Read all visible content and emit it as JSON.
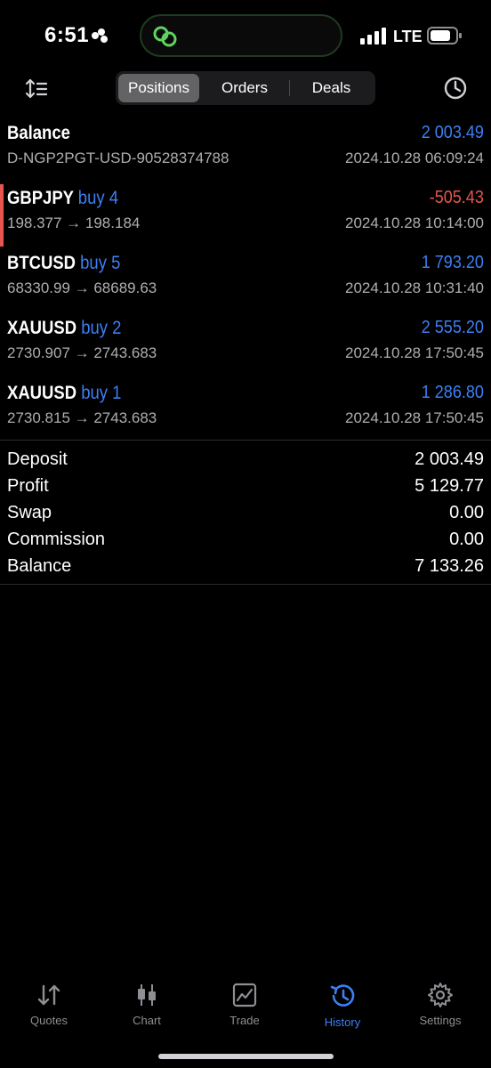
{
  "status": {
    "time": "6:51",
    "network": "LTE"
  },
  "segment": {
    "tabs": [
      "Positions",
      "Orders",
      "Deals"
    ],
    "active": 0
  },
  "balance_row": {
    "label": "Balance",
    "value": "2 003.49",
    "account": "D-NGP2PGT-USD-90528374788",
    "date": "2024.10.28 06:09:24"
  },
  "deals": [
    {
      "symbol": "GBPJPY",
      "side": "buy 4",
      "value": "-505.43",
      "prices": "198.377 → 198.184",
      "date": "2024.10.28 10:14:00"
    },
    {
      "symbol": "BTCUSD",
      "side": "buy 5",
      "value": "1 793.20",
      "prices": "68330.99 → 68689.63",
      "date": "2024.10.28 10:31:40"
    },
    {
      "symbol": "XAUUSD",
      "side": "buy 2",
      "value": "2 555.20",
      "prices": "2730.907 → 2743.683",
      "date": "2024.10.28 17:50:45"
    },
    {
      "symbol": "XAUUSD",
      "side": "buy 1",
      "value": "1 286.80",
      "prices": "2730.815 → 2743.683",
      "date": "2024.10.28 17:50:45"
    }
  ],
  "summary": [
    {
      "label": "Deposit",
      "value": "2 003.49"
    },
    {
      "label": "Profit",
      "value": "5 129.77"
    },
    {
      "label": "Swap",
      "value": "0.00"
    },
    {
      "label": "Commission",
      "value": "0.00"
    },
    {
      "label": "Balance",
      "value": "7 133.26"
    }
  ],
  "tabbar": [
    {
      "label": "Quotes",
      "icon": "quotes-arrows-icon"
    },
    {
      "label": "Chart",
      "icon": "candlestick-icon"
    },
    {
      "label": "Trade",
      "icon": "trade-chart-icon"
    },
    {
      "label": "History",
      "icon": "history-clock-icon"
    },
    {
      "label": "Settings",
      "icon": "gear-icon"
    }
  ],
  "colors": {
    "accent": "#3d7ff5",
    "negative": "#e8554e",
    "muted": "#aeaeb2"
  }
}
